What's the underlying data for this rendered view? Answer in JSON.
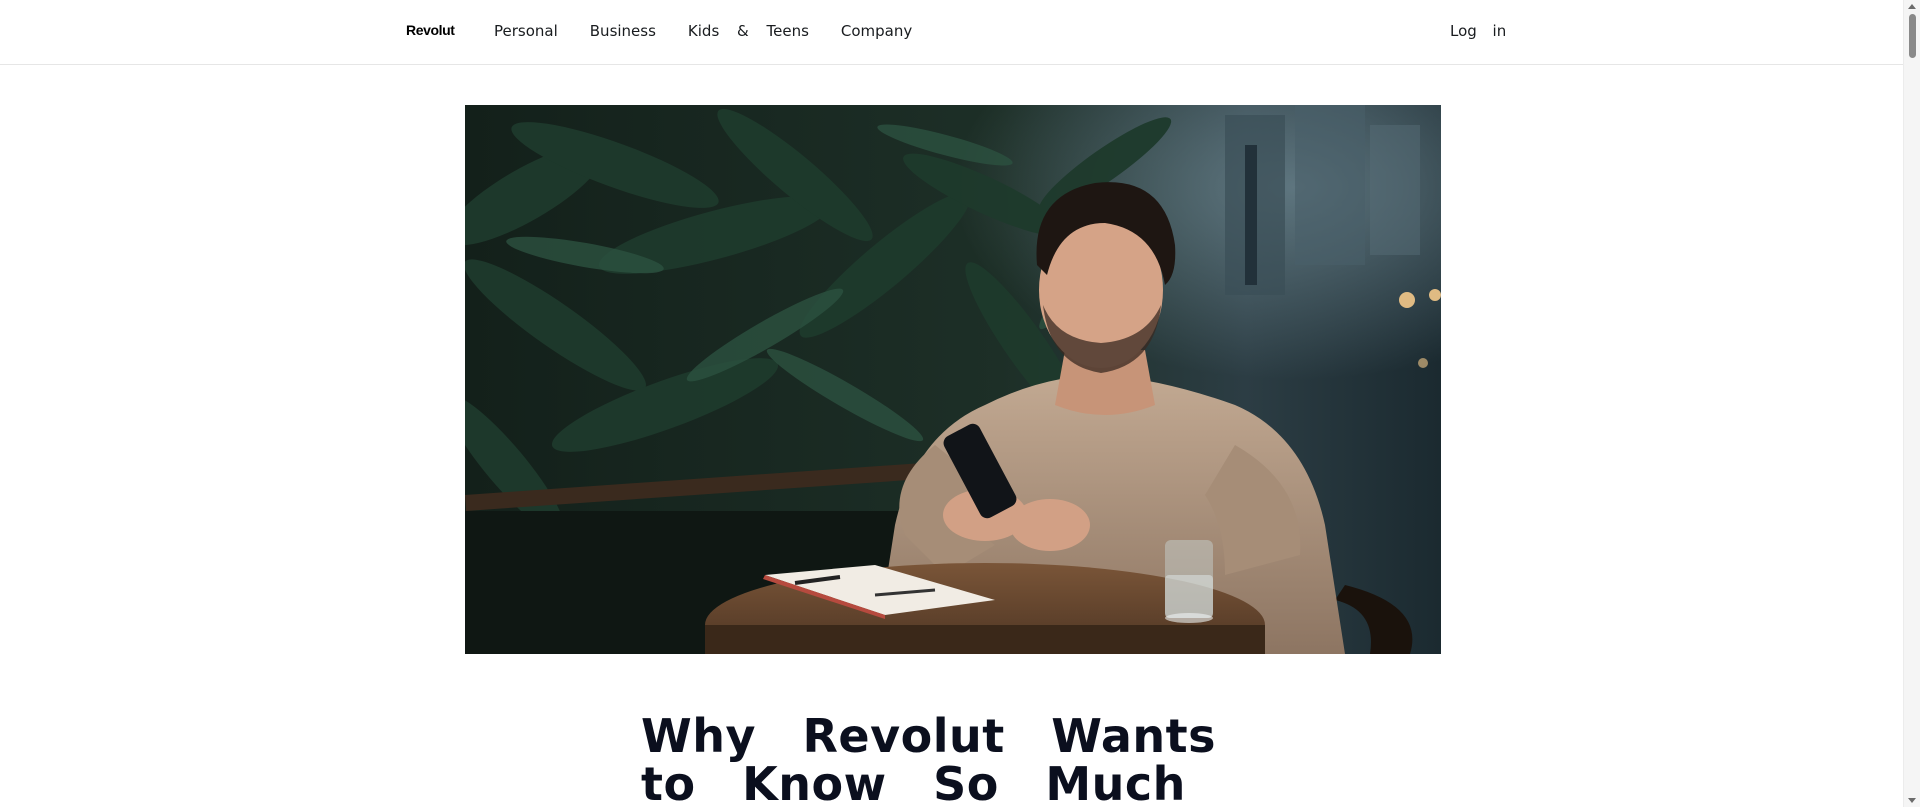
{
  "header": {
    "logo": "Revolut",
    "nav": [
      {
        "label": "Personal"
      },
      {
        "label": "Business"
      },
      {
        "label": "Kids & Teens"
      },
      {
        "label": "Company"
      }
    ],
    "login_label": "Log in"
  },
  "hero": {
    "image": "photo-man-using-smartphone-at-cafe-table",
    "colors": {
      "foliage": "#1e3a2c",
      "sweater": "#b59c86",
      "table": "#6b4a31"
    }
  },
  "article": {
    "title": "Why Revolut Wants to Know So Much"
  },
  "colors": {
    "text": "#191c1f",
    "headline": "#0b0f1e",
    "divider": "#e6e6e6"
  }
}
